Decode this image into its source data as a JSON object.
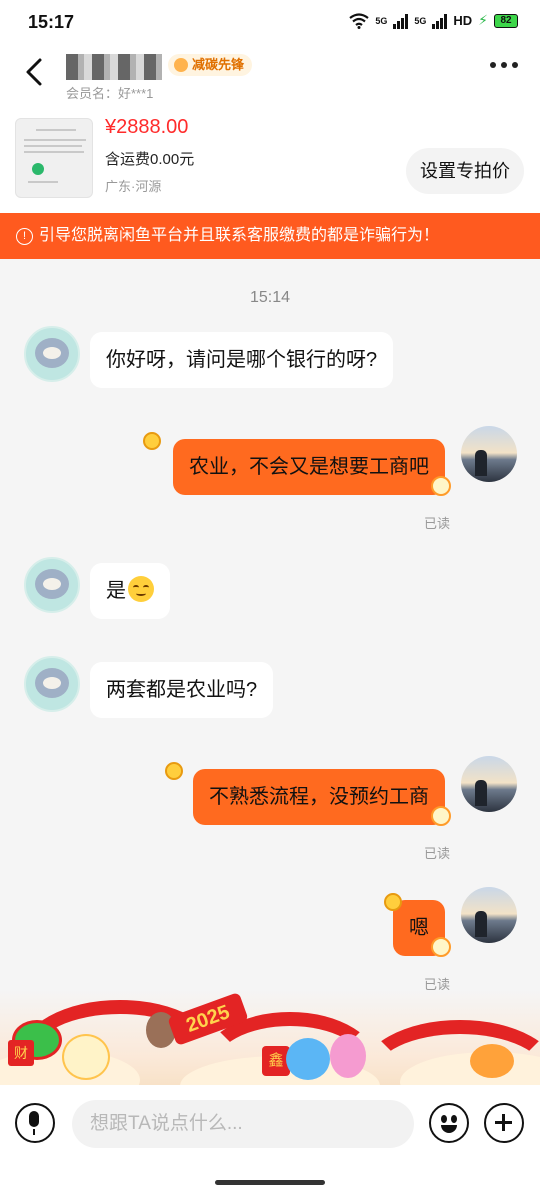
{
  "status_bar": {
    "time": "15:17",
    "network_1": "5G",
    "network_2": "5G",
    "hd": "HD",
    "battery": "82"
  },
  "header": {
    "badge": "减碳先锋",
    "member_label": "会员名：好***1"
  },
  "product": {
    "price": "¥2888.00",
    "shipping": "含运费0.00元",
    "location": "广东·河源",
    "special_price_button": "设置专拍价"
  },
  "warning": {
    "icon": "!",
    "text": "引导您脱离闲鱼平台并且联系客服缴费的都是诈骗行为！"
  },
  "chat": {
    "timestamp": "15:14",
    "messages": [
      {
        "side": "in",
        "text": "你好呀，请问是哪个银行的呀?"
      },
      {
        "side": "out",
        "text": "农业，不会又是想要工商吧",
        "status": "已读"
      },
      {
        "side": "in",
        "text": "是",
        "emoji": "smiling-face-emoji"
      },
      {
        "side": "in",
        "text": "两套都是农业吗?"
      },
      {
        "side": "out",
        "text": "不熟悉流程，没预约工商",
        "status": "已读"
      },
      {
        "side": "out",
        "text": "嗯",
        "status": "已读"
      }
    ]
  },
  "banner": {
    "tag": "2025",
    "tag_left": "财",
    "tag_right": "鑫"
  },
  "input_bar": {
    "placeholder": "想跟TA说点什么..."
  },
  "colors": {
    "accent": "#ff6a1f",
    "warning_bg": "#ff5a1f",
    "price": "#ff2b2b"
  },
  "icons": [
    "back-arrow-icon",
    "more-icon",
    "microphone-icon",
    "emoji-icon",
    "plus-icon",
    "warning-icon"
  ]
}
